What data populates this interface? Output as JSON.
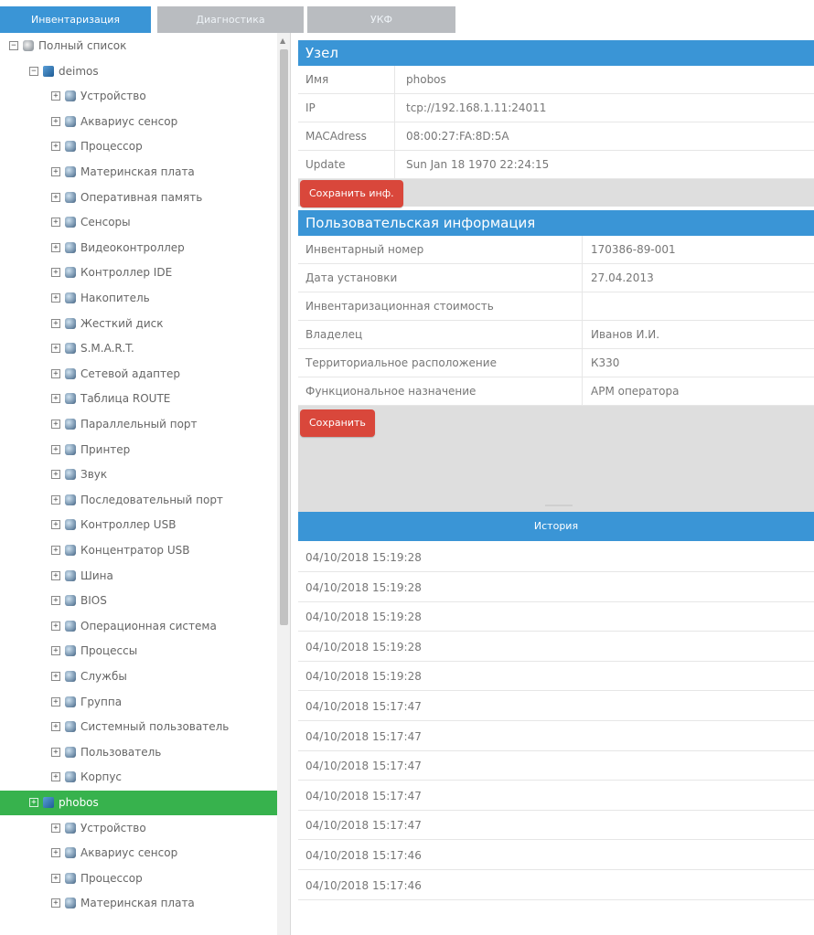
{
  "tabs": [
    "Инвентаризация",
    "Диагностика",
    "УКФ"
  ],
  "tree": {
    "root": "Полный список",
    "host1": "deimos",
    "host1_items": [
      "Устройство",
      "Аквариус сенсор",
      "Процессор",
      "Материнская плата",
      "Оперативная память",
      "Сенсоры",
      "Видеоконтроллер",
      "Контроллер IDE",
      "Накопитель",
      "Жесткий диск",
      "S.M.A.R.T.",
      "Сетевой адаптер",
      "Таблица ROUTE",
      "Параллельный порт",
      "Принтер",
      "Звук",
      "Последовательный порт",
      "Контроллер USB",
      "Концентратор USB",
      "Шина",
      "BIOS",
      "Операционная система",
      "Процессы",
      "Службы",
      "Группа",
      "Системный пользователь",
      "Пользователь",
      "Корпус"
    ],
    "host2": "phobos",
    "host2_items": [
      "Устройство",
      "Аквариус сенсор",
      "Процессор",
      "Материнская плата"
    ]
  },
  "node": {
    "header": "Узел",
    "rows": [
      {
        "key": "Имя",
        "value": "phobos"
      },
      {
        "key": "IP",
        "value": "tcp://192.168.1.11:24011"
      },
      {
        "key": "MACAdress",
        "value": "08:00:27:FA:8D:5A"
      },
      {
        "key": "Update",
        "value": "Sun Jan 18 1970 22:24:15"
      }
    ],
    "save_label": "Сохранить инф."
  },
  "user_info": {
    "header": "Пользовательская информация",
    "rows": [
      {
        "key": "Инвентарный номер",
        "value": "170386-89-001"
      },
      {
        "key": "Дата установки",
        "value": "27.04.2013"
      },
      {
        "key": "Инвентаризационная стоимость",
        "value": ""
      },
      {
        "key": "Владелец",
        "value": "Иванов И.И."
      },
      {
        "key": "Территориальное расположение",
        "value": "К330"
      },
      {
        "key": "Функциональное назначение",
        "value": "АРМ оператора"
      }
    ],
    "save_label": "Сохранить"
  },
  "history": {
    "header": "История",
    "rows": [
      "04/10/2018 15:19:28",
      "04/10/2018 15:19:28",
      "04/10/2018 15:19:28",
      "04/10/2018 15:19:28",
      "04/10/2018 15:19:28",
      "04/10/2018 15:17:47",
      "04/10/2018 15:17:47",
      "04/10/2018 15:17:47",
      "04/10/2018 15:17:47",
      "04/10/2018 15:17:47",
      "04/10/2018 15:17:46",
      "04/10/2018 15:17:46"
    ]
  },
  "colors": {
    "accent": "#3a95d6",
    "selected": "#37b24d",
    "button": "#d9473b"
  }
}
